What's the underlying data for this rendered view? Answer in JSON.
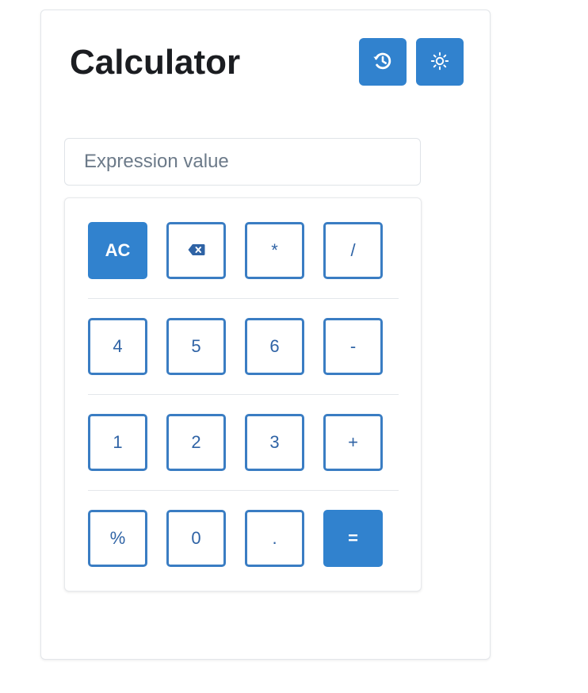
{
  "app": {
    "title": "Calculator"
  },
  "header": {
    "history_icon": "history-icon",
    "theme_icon": "sun-icon"
  },
  "expression": {
    "placeholder": "Expression value",
    "value": ""
  },
  "keypad": {
    "rows": [
      [
        {
          "label": "AC",
          "style": "solid"
        },
        {
          "label": "",
          "icon": "backspace-icon",
          "style": "outline"
        },
        {
          "label": "*",
          "style": "outline"
        },
        {
          "label": "/",
          "style": "outline"
        }
      ],
      [
        {
          "label": "4",
          "style": "outline"
        },
        {
          "label": "5",
          "style": "outline"
        },
        {
          "label": "6",
          "style": "outline"
        },
        {
          "label": "-",
          "style": "outline"
        }
      ],
      [
        {
          "label": "1",
          "style": "outline"
        },
        {
          "label": "2",
          "style": "outline"
        },
        {
          "label": "3",
          "style": "outline"
        },
        {
          "label": "+",
          "style": "outline"
        }
      ],
      [
        {
          "label": "%",
          "style": "outline"
        },
        {
          "label": "0",
          "style": "outline"
        },
        {
          "label": ".",
          "style": "outline"
        },
        {
          "label": "=",
          "style": "solid"
        }
      ]
    ]
  },
  "colors": {
    "accent": "#3182ce",
    "outline_border": "#3a7dc3",
    "outline_text": "#2f63a5",
    "title_text": "#1b1d21"
  }
}
